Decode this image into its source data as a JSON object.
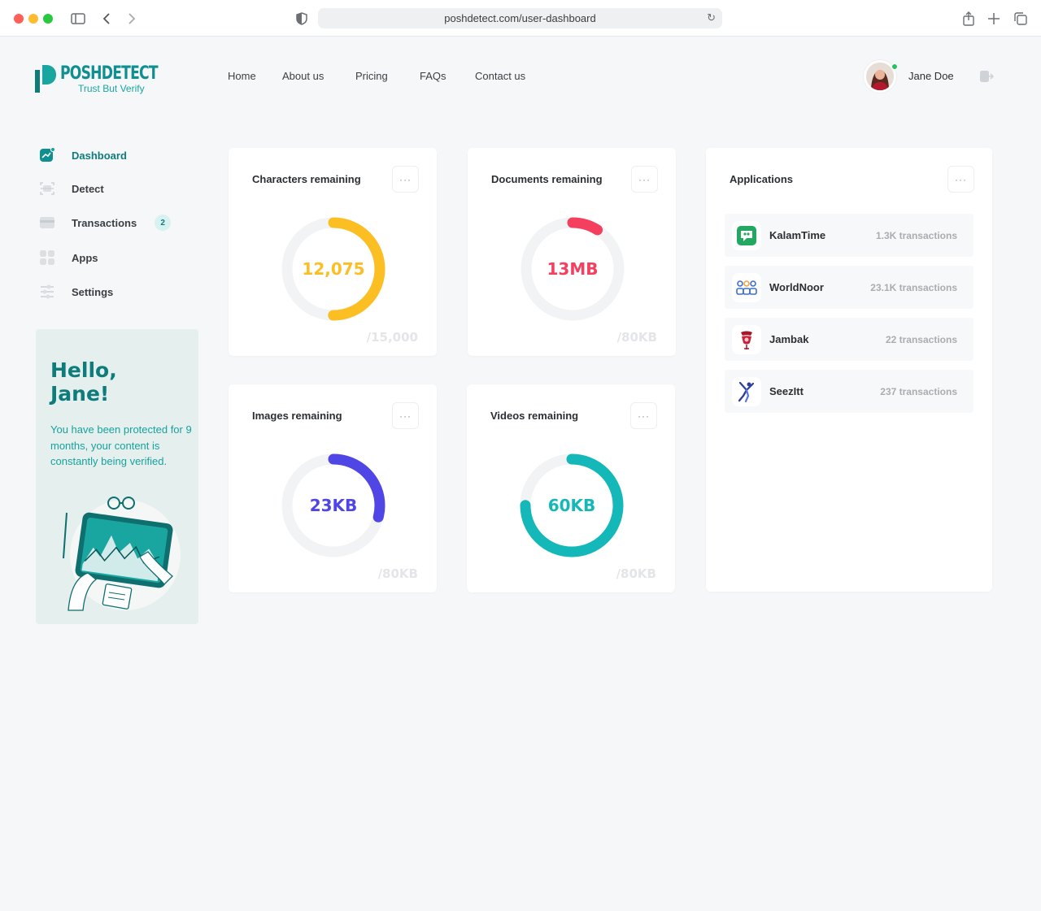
{
  "browser": {
    "url": "poshdetect.com/user-dashboard",
    "dots": [
      "#fe5f57",
      "#febc2e",
      "#28c840"
    ]
  },
  "brand": {
    "name": "POSHDETECT",
    "tagline": "Trust But Verify",
    "color": "#0f8f8f"
  },
  "nav": {
    "items": [
      "Home",
      "About us",
      "Pricing",
      "FAQs",
      "Contact us"
    ]
  },
  "user": {
    "name": "Jane Doe",
    "status": "online"
  },
  "sidebar": {
    "items": [
      {
        "label": "Dashboard",
        "icon": "chart-icon",
        "active": true
      },
      {
        "label": "Detect",
        "icon": "scan-icon"
      },
      {
        "label": "Transactions",
        "icon": "card-icon",
        "badge": "2"
      },
      {
        "label": "Apps",
        "icon": "grid-icon"
      },
      {
        "label": "Settings",
        "icon": "sliders-icon"
      }
    ]
  },
  "hello": {
    "greeting_line1": "Hello,",
    "greeting_line2": "Jane!",
    "message": "You have been protected for 9 months, your content is constantly being verified."
  },
  "cards": [
    {
      "title": "Characters remaining",
      "value": "12,075",
      "total": "/15,000",
      "fraction": 0.5,
      "start": 0.0,
      "color": "#fbbf24"
    },
    {
      "title": "Documents remaining",
      "value": "13MB",
      "total": "/80KB",
      "fraction": 0.09,
      "start": 0.0,
      "color": "#f43f5e"
    },
    {
      "title": "Images remaining",
      "value": "23KB",
      "total": "/80KB",
      "fraction": 0.29,
      "start": 0.0,
      "color": "#4f46e5"
    },
    {
      "title": "Videos remaining",
      "value": "60KB",
      "total": "/80KB",
      "fraction": 0.75,
      "start": 0.0,
      "color": "#14b8b8"
    }
  ],
  "applications": {
    "title": "Applications",
    "items": [
      {
        "name": "KalamTime",
        "transactions": "1.3K transactions",
        "icon": "kalamtime-logo-icon"
      },
      {
        "name": "WorldNoor",
        "transactions": "23.1K transactions",
        "icon": "worldnoor-logo-icon"
      },
      {
        "name": "Jambak",
        "transactions": "22 transactions",
        "icon": "jambak-logo-icon"
      },
      {
        "name": "SeezItt",
        "transactions": "237 transactions",
        "icon": "seezitt-logo-icon"
      }
    ]
  },
  "more_label": "···"
}
